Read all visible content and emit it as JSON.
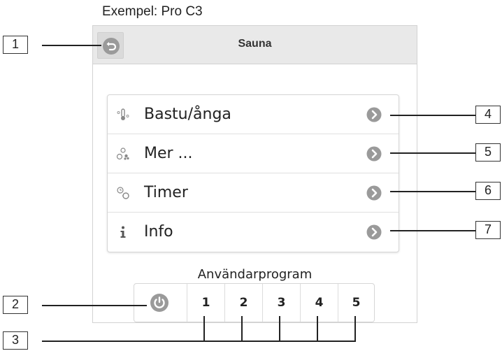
{
  "caption": "Exempel: Pro C3",
  "header": {
    "title": "Sauna",
    "back_icon": "back-arrow-icon"
  },
  "menu": {
    "items": [
      {
        "label": "Bastu/ånga",
        "icon": "thermometer-icon"
      },
      {
        "label": "Mer ...",
        "icon": "extras-icon"
      },
      {
        "label": "Timer",
        "icon": "timer-icon"
      },
      {
        "label": "Info",
        "icon": "info-icon"
      }
    ]
  },
  "programs": {
    "title": "Användarprogram",
    "power_icon": "power-icon",
    "buttons": [
      "1",
      "2",
      "3",
      "4",
      "5"
    ]
  },
  "callouts": [
    "1",
    "2",
    "3",
    "4",
    "5",
    "6",
    "7"
  ],
  "colors": {
    "icon_gray": "#9a9a9a",
    "header_bg": "#e9e9e9"
  }
}
